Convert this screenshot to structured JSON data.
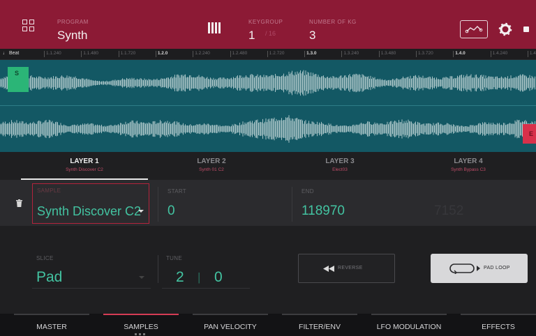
{
  "header": {
    "program_label": "PROGRAM",
    "program_value": "Synth",
    "keygroup_label": "KEYGROUP",
    "keygroup_value": "1",
    "keygroup_total": "/ 16",
    "num_keygroups_label": "NUMBER OF KG",
    "num_keygroups_value": "3",
    "icons": [
      "grid-icon",
      "piano-keys-icon",
      "automation-icon",
      "gear-icon",
      "more-icon"
    ]
  },
  "ruler": {
    "beat_label": "♩ Beat",
    "ticks": [
      {
        "label": "1.1.240",
        "bold": false
      },
      {
        "label": "1.1.480",
        "bold": false
      },
      {
        "label": "1.1.720",
        "bold": false
      },
      {
        "label": "1.2.0",
        "bold": true
      },
      {
        "label": "1.2.240",
        "bold": false
      },
      {
        "label": "1.2.480",
        "bold": false
      },
      {
        "label": "1.2.720",
        "bold": false
      },
      {
        "label": "1.3.0",
        "bold": true
      },
      {
        "label": "1.3.240",
        "bold": false
      },
      {
        "label": "1.3.480",
        "bold": false
      },
      {
        "label": "1.3.720",
        "bold": false
      },
      {
        "label": "1.4.0",
        "bold": true
      },
      {
        "label": "1.4.240",
        "bold": false
      },
      {
        "label": "1.4",
        "bold": false
      }
    ]
  },
  "waveform": {
    "start_marker": "S",
    "end_marker": "E",
    "color": "#135864",
    "wave_color": "#e6f1f1"
  },
  "layers": [
    {
      "name": "LAYER 1",
      "sample": "Synth Discover C2",
      "active": true
    },
    {
      "name": "LAYER 2",
      "sample": "Synth 01 C2",
      "active": false
    },
    {
      "name": "LAYER 3",
      "sample": "Elect03",
      "active": false
    },
    {
      "name": "LAYER 4",
      "sample": "Synth Bypass C3",
      "active": false
    }
  ],
  "sample_row": {
    "sample_label": "SAMPLE",
    "sample_value": "Synth Discover C2",
    "start_label": "START",
    "start_value": "0",
    "end_label": "END",
    "end_value": "118970",
    "extra_value": "7152"
  },
  "lower": {
    "slice_label": "SLICE",
    "slice_value": "Pad",
    "tune_label": "TUNE",
    "tune_semi": "2",
    "tune_sep": "|",
    "tune_fine": "0",
    "reverse_label": "REVERSE",
    "pad_loop_label": "PAD LOOP"
  },
  "bottom_tabs": [
    {
      "label": "MASTER",
      "active": false
    },
    {
      "label": "SAMPLES",
      "active": true
    },
    {
      "label": "PAN VELOCITY",
      "active": false
    },
    {
      "label": "FILTER/ENV",
      "active": false
    },
    {
      "label": "LFO MODULATION",
      "active": false
    },
    {
      "label": "EFFECTS",
      "active": false
    }
  ],
  "colors": {
    "header": "#8c1a35",
    "accent_red": "#d43c55",
    "value_green": "#43c3a1",
    "start_marker": "#2bb577",
    "end_marker": "#d8304a"
  }
}
